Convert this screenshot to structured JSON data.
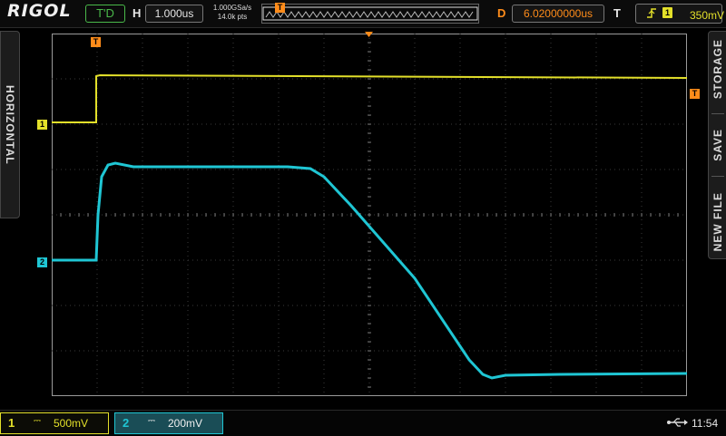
{
  "header": {
    "logo": "RIGOL",
    "run_status": "T'D",
    "timebase_label": "H",
    "timebase_value": "1.000us",
    "sample_rate": "1.000GSa/s",
    "memory_depth": "14.0k pts",
    "delay_label": "D",
    "delay_value": "6.02000000us",
    "trigger_label": "T",
    "trigger_edge_icon": "rising-edge-icon",
    "trigger_channel": "1",
    "trigger_level": "350mV"
  },
  "side_tabs": {
    "left": "HORIZONTAL",
    "right_items": [
      "STORAGE",
      "SAVE",
      "NEW FILE"
    ]
  },
  "markers": {
    "ch1": "1",
    "ch2": "2",
    "trigger_position": "T",
    "trigger_level_marker": "T"
  },
  "channels": [
    {
      "number": "1",
      "coupling_icon": "dc-coupling-icon",
      "scale": "500mV",
      "color": "#e3e02a"
    },
    {
      "number": "2",
      "coupling_icon": "dc-coupling-icon",
      "scale": "200mV",
      "color": "#1fc6d4"
    }
  ],
  "status": {
    "usb_icon": "usb-icon",
    "time": "11:54"
  },
  "colors": {
    "ch1": "#e3e02a",
    "ch2": "#1fc6d4",
    "trigger": "#ff8c1a",
    "run_status": "#4ab94a"
  }
}
